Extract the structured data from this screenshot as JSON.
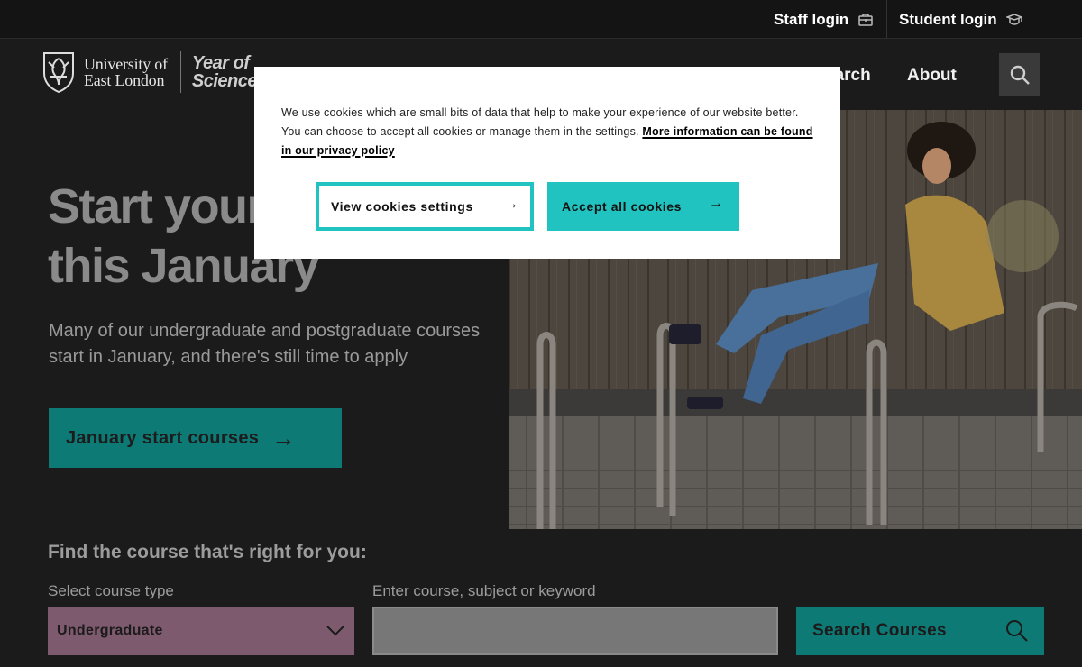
{
  "utility": {
    "staff_login": "Staff login",
    "student_login": "Student login"
  },
  "header": {
    "logo_line1": "University of",
    "logo_line2": "East London",
    "year_line1": "Year of",
    "year_line2": "Science",
    "nav": {
      "research": "earch",
      "about": "About"
    }
  },
  "hero": {
    "title_line1": "Start your",
    "title_line2": "this January",
    "subtitle": "Many of our undergraduate and postgraduate courses start in January, and there's still time to apply",
    "cta_label": "January start courses"
  },
  "finder": {
    "title": "Find the course that's right for you:",
    "type_label": "Select course type",
    "type_value": "Undergraduate",
    "keyword_label": "Enter course, subject or keyword",
    "keyword_value": "",
    "search_button": "Search Courses"
  },
  "cookie": {
    "text": "We use cookies which are small bits of data that help to make your experience of our website better. You can choose to accept all cookies or manage them in the settings.",
    "link": "More information can be found in our privacy policy",
    "settings_button": "View cookies settings",
    "accept_button": "Accept all cookies",
    "arrow": "→"
  },
  "colors": {
    "background": "#1b1b1b",
    "teal": "#21c3c0",
    "teal_dimmed": "#0e7a76",
    "select_bg": "#7e5a6e"
  },
  "icons": {
    "staff": "briefcase-icon",
    "student": "mortarboard-icon",
    "search": "search-icon",
    "select": "chevron-down-icon"
  }
}
